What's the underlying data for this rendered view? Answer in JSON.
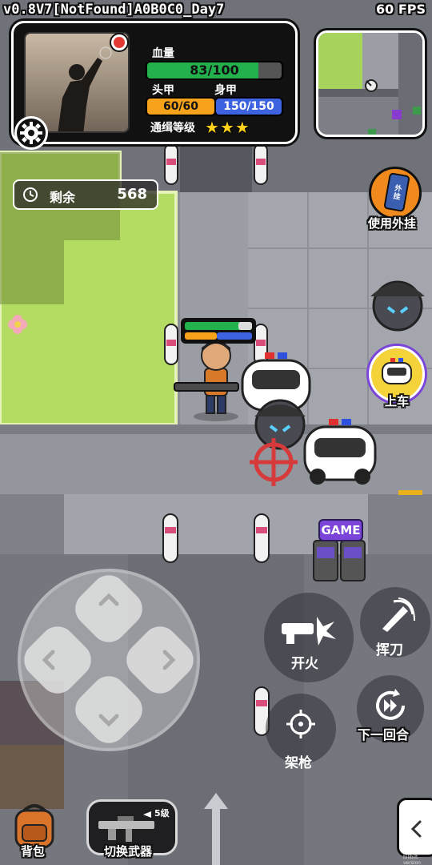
{
  "hud": {
    "version": "v0.8V7[NotFound]A0B0C0_Day7",
    "fps": "60 FPS",
    "watermark": "bilibilt version"
  },
  "player_card": {
    "hp_label": "血量",
    "hp_text": "83/100",
    "hp_fraction": 0.83,
    "helmet_label": "头甲",
    "helmet_text": "60/60",
    "armor_label": "身甲",
    "armor_text": "150/150",
    "wanted_label": "通缉等级",
    "wanted_stars": 3
  },
  "timer": {
    "label": "剩余",
    "value": "568"
  },
  "side_buttons": {
    "cheat_label": "使用外挂",
    "cheat_icon_text": "外挂",
    "car_label": "上车"
  },
  "map_sign": "GAME",
  "controls": {
    "fire_label": "开火",
    "melee_label": "挥刀",
    "aim_label": "架枪",
    "next_round_label": "下一回合",
    "switch_weapon_label": "切换武器",
    "weapon_level": "5级",
    "backpack_label": "背包",
    "collapse_icon": "chevron-left-icon"
  },
  "colors": {
    "hp": "#22b14c",
    "helmet": "#f7a21b",
    "armor": "#3d63e0",
    "star": "#ffd21a",
    "grass": "#b5dc62"
  }
}
